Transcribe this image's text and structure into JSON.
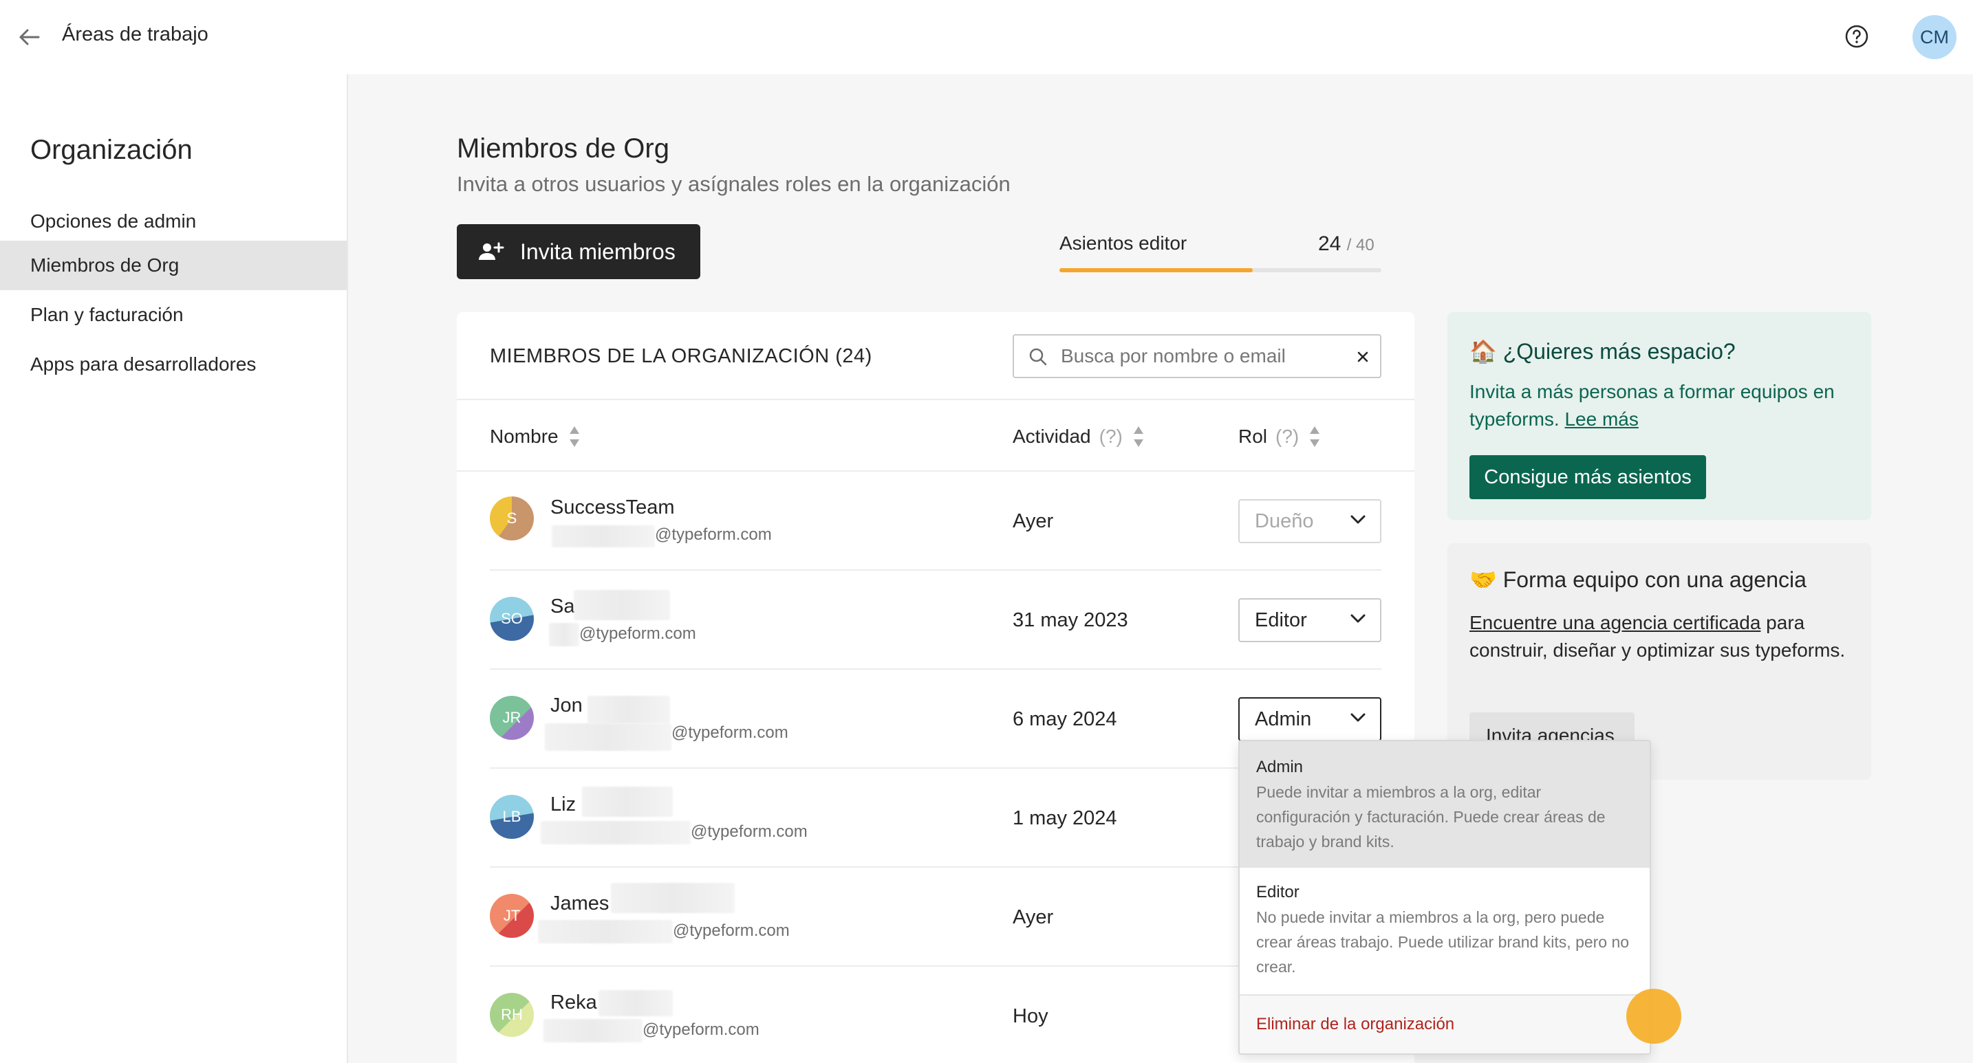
{
  "topbar": {
    "back_title": "Áreas de trabajo",
    "user_initials": "CM"
  },
  "sidebar": {
    "title": "Organización",
    "items": [
      {
        "label": "Opciones de admin",
        "active": false
      },
      {
        "label": "Miembros de Org",
        "active": true
      },
      {
        "label": "Plan y facturación",
        "active": false
      },
      {
        "label": "Apps para desarrolladores",
        "active": false
      }
    ]
  },
  "page": {
    "title": "Miembros de Org",
    "subtitle": "Invita a otros usuarios y asígnales roles en la organización",
    "invite_button": "Invita miembros"
  },
  "seats": {
    "label": "Asientos editor",
    "used": "24",
    "total": "/ 40",
    "fill_fraction": 0.6,
    "fill_color": "#f6a52d"
  },
  "members_card": {
    "title": "MIEMBROS DE LA ORGANIZACIÓN (24)",
    "search_placeholder": "Busca por nombre o email",
    "columns": {
      "name": "Nombre",
      "activity": "Actividad",
      "activity_hint": "(?)",
      "role": "Rol",
      "role_hint": "(?)"
    },
    "members": [
      {
        "initials": "S",
        "name": "SuccessTeam",
        "email": "@typeform.com",
        "activity": "Ayer",
        "role": "Dueño",
        "role_disabled": true
      },
      {
        "initials": "SO",
        "name": "Sa",
        "email": "@typeform.com",
        "activity": "31 may 2023",
        "role": "Editor"
      },
      {
        "initials": "JR",
        "name": "Jon",
        "email": "@typeform.com",
        "activity": "6 may 2024",
        "role": "Admin",
        "open": true
      },
      {
        "initials": "LB",
        "name": "Liz",
        "email": "@typeform.com",
        "activity": "1 may 2024"
      },
      {
        "initials": "JT",
        "name": "James",
        "email": "@typeform.com",
        "activity": "Ayer"
      },
      {
        "initials": "RH",
        "name": "Reka",
        "email": "@typeform.com",
        "activity": "Hoy"
      }
    ]
  },
  "role_menu": {
    "options": [
      {
        "name": "Admin",
        "desc": "Puede invitar a miembros a la org, editar configuración y facturación. Puede crear áreas de trabajo y brand kits.",
        "selected": true
      },
      {
        "name": "Editor",
        "desc": "No puede invitar a miembros a la org, pero puede crear áreas trabajo. Puede utilizar brand kits, pero no crear.",
        "selected": false
      }
    ],
    "remove_label": "Eliminar de la organización"
  },
  "promo_space": {
    "emoji": "🏠",
    "title": "¿Quieres más espacio?",
    "text": "Invita a más personas a formar equipos en typeforms.",
    "link": "Lee más",
    "button": "Consigue más asientos"
  },
  "promo_agency": {
    "emoji": "🤝",
    "title": "Forma equipo con una agencia",
    "link": "Encuentre una agencia certificada",
    "text": "para construir, diseñar y optimizar sus typeforms.",
    "button": "Invita agencias"
  }
}
